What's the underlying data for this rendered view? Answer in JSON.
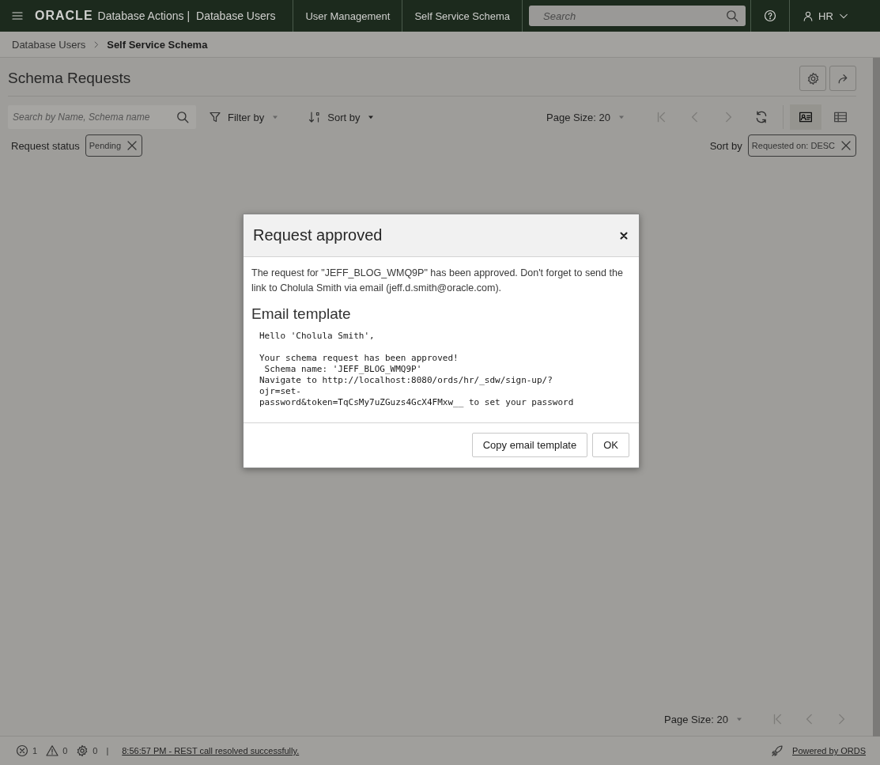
{
  "header": {
    "logo": "ORACLE",
    "app_title": "Database Actions |",
    "section": "Database Users",
    "nav": [
      {
        "label": "User Management"
      },
      {
        "label": "Self Service Schema"
      }
    ],
    "search": {
      "placeholder": "Search"
    },
    "user": "HR"
  },
  "breadcrumb": [
    {
      "label": "Database Users",
      "current": false
    },
    {
      "label": "Self Service Schema",
      "current": true
    }
  ],
  "page": {
    "title": "Schema Requests",
    "search": {
      "placeholder": "Search by Name, Schema name"
    },
    "filter_by": "Filter by",
    "sort_by": "Sort by",
    "page_size": "Page Size: 20",
    "pager": [
      {
        "kind": "first",
        "disabled": true
      },
      {
        "kind": "prev",
        "disabled": true
      },
      {
        "kind": "next",
        "disabled": true
      },
      {
        "kind": "refresh",
        "disabled": false
      }
    ],
    "views": [
      {
        "kind": "card",
        "selected": true
      },
      {
        "kind": "table",
        "selected": false
      }
    ],
    "filter": {
      "label": "Request status",
      "chip": "Pending"
    },
    "sort": {
      "label": "Sort by",
      "chip": "Requested on: DESC"
    },
    "bottom_pager": {
      "page_size": "Page Size: 20",
      "pager": [
        {
          "kind": "first",
          "disabled": true
        },
        {
          "kind": "prev",
          "disabled": true
        },
        {
          "kind": "next",
          "disabled": true
        }
      ]
    }
  },
  "status_bar": {
    "errors": "1",
    "warnings": "0",
    "tasks": "0",
    "separator": "|",
    "message": "8:56:57 PM - REST call resolved successfully.",
    "powered": "Powered by ORDS"
  },
  "dialog": {
    "title": "Request approved",
    "message": "The request for \"JEFF_BLOG_WMQ9P\" has been approved. Don't forget to send the link to Cholula Smith via email (jeff.d.smith@oracle.com).",
    "heading": "Email template",
    "template": "Hello 'Cholula Smith',\n\nYour schema request has been approved!\n Schema name: 'JEFF_BLOG_WMQ9P'\nNavigate to http://localhost:8080/ords/hr/_sdw/sign-up/?\nojr=set-\npassword&token=TqCsMy7uZGuzs4GcX4FMxw__ to set your password",
    "buttons": [
      {
        "label": "Copy email template"
      },
      {
        "label": "OK"
      }
    ]
  }
}
